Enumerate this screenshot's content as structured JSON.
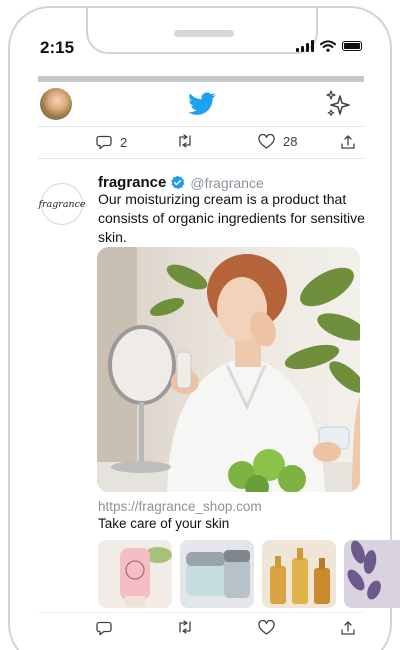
{
  "status_bar": {
    "time": "2:15"
  },
  "header": {
    "avatar_icon": "user-avatar",
    "logo_icon": "twitter-bird-icon",
    "sparkle_icon": "sparkle-icon",
    "brand_color": "#1da1f2"
  },
  "previous_tweet": {
    "replies": "2",
    "likes": "28"
  },
  "tweet": {
    "display_name": "fragrance",
    "handle": "@fragrance",
    "verified": true,
    "avatar_text": "fragrance",
    "text": "Our moisturizing cream is a product that consists of organic ingredients for sensitive skin.",
    "link": {
      "url": "https://fragrance_shop.com",
      "title": "Take care of your skin"
    }
  }
}
